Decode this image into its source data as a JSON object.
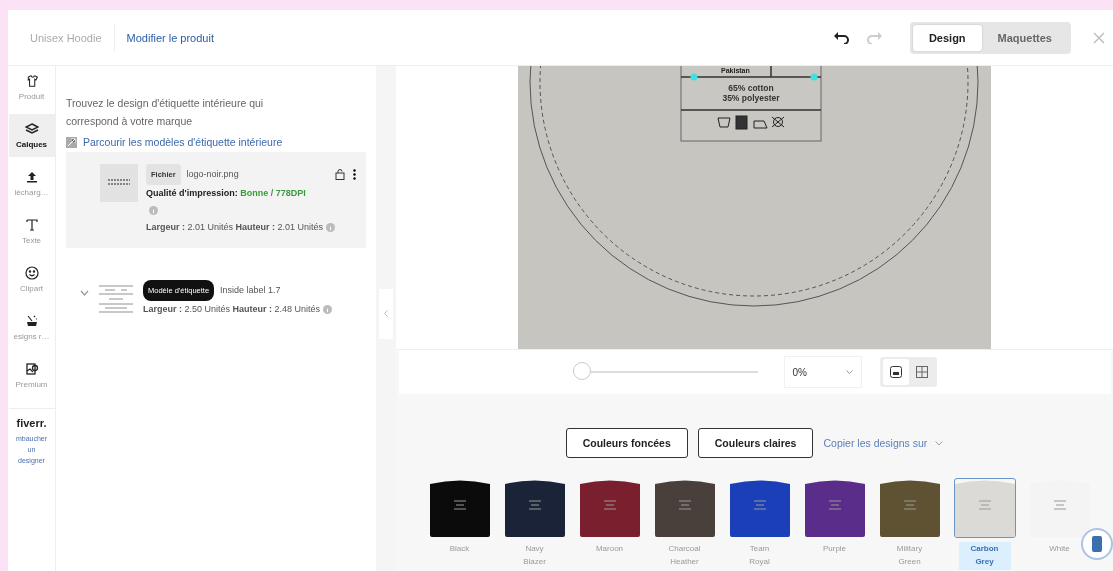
{
  "header": {
    "breadcrumb": [
      {
        "label": "Unisex Hoodie",
        "selected": false
      },
      {
        "label": "Modifier le produit",
        "selected": true
      }
    ],
    "modes": [
      {
        "label": "Design",
        "selected": true
      },
      {
        "label": "Maquettes",
        "selected": false
      }
    ]
  },
  "rail": [
    {
      "label": "Produit",
      "selected": false
    },
    {
      "label": "Calques",
      "selected": true
    },
    {
      "label": "lécharg…",
      "selected": false
    },
    {
      "label": "Texte",
      "selected": false
    },
    {
      "label": "Clipart",
      "selected": false
    },
    {
      "label": "esigns r…",
      "selected": false
    },
    {
      "label": "Premium",
      "selected": false
    }
  ],
  "fiverr": {
    "logo": "fiverr.",
    "link": "mbaucher un designer"
  },
  "panel": {
    "intro": "Trouvez le design d'étiquette intérieure qui correspond à votre marque",
    "browse_link": "Parcourir les modèles d'étiquette intérieure",
    "layers": [
      {
        "kind": "file",
        "tag": "Fichier",
        "name": "logo-noir.png",
        "quality_label": "Qualité d'impression:",
        "quality_value": "Bonne / 778DPI",
        "dimensions": "**Largeur :** 2.01 Unités **Hauteur :** 2.01 Unités",
        "selected": true
      },
      {
        "kind": "template",
        "tag": "Modèle d'étiquette",
        "name": "Inside label 1.7",
        "dimensions": "**Largeur :** 2.50 Unités **Hauteur :** 2.48 Unités",
        "selected": false,
        "expanded": false
      }
    ]
  },
  "canvas": {
    "label_lines": [
      "Pakistan",
      "65% cotton",
      "35% polyester"
    ]
  },
  "zoom": {
    "level": 0,
    "reading": "0%",
    "views": [
      {
        "selected": true
      },
      {
        "selected": false
      }
    ]
  },
  "color_buttons": [
    {
      "label": "Couleurs foncées"
    },
    {
      "label": "Couleurs claires"
    }
  ],
  "copy_link": "Copier les designs sur",
  "swatches": [
    {
      "name": "Black",
      "color": "#0b0b0c",
      "selected": false
    },
    {
      "name": "Navy Blazer",
      "color": "#1b2338",
      "selected": false
    },
    {
      "name": "Maroon",
      "color": "#7a1f2e",
      "selected": false
    },
    {
      "name": "Charcoal Heather",
      "color": "#4a403b",
      "selected": false
    },
    {
      "name": "Team Royal",
      "color": "#1b3fb8",
      "selected": false
    },
    {
      "name": "Purple",
      "color": "#5b2d8a",
      "selected": false
    },
    {
      "name": "Military Green",
      "color": "#5e5233",
      "selected": false
    },
    {
      "name": "Carbon Grey",
      "color": "#dcdad6",
      "selected": true
    },
    {
      "name": "White",
      "color": "#f4f4f4",
      "selected": false
    }
  ]
}
